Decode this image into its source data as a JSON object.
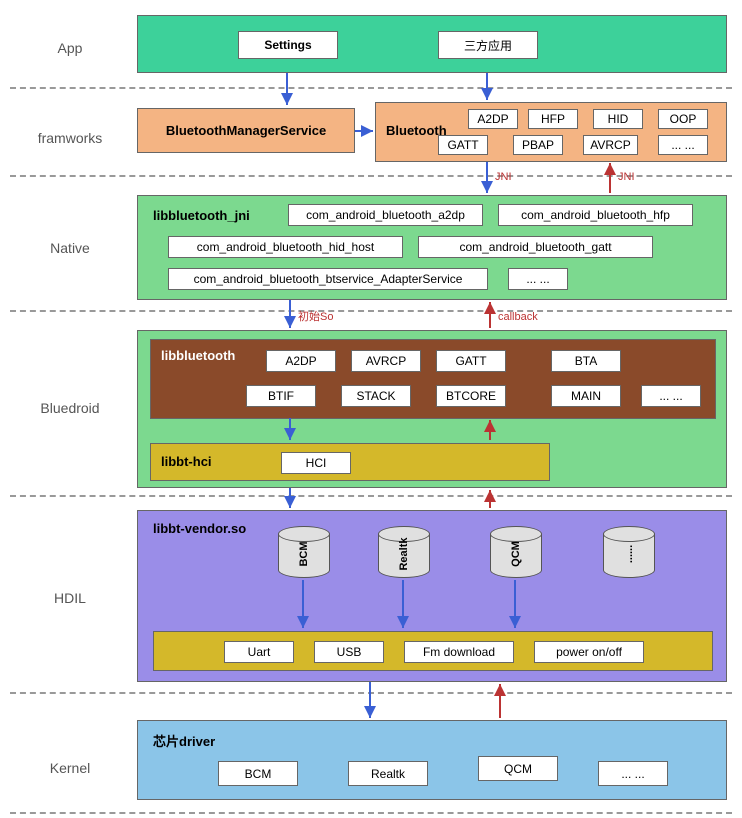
{
  "layers": {
    "app": "App",
    "frameworks": "framworks",
    "native": "Native",
    "bluedroid": "Bluedroid",
    "hdil": "HDIL",
    "kernel": "Kernel"
  },
  "app": {
    "settings": "Settings",
    "third_party": "三方应用"
  },
  "frameworks": {
    "bms": "BluetoothManagerService",
    "bluetooth": "Bluetooth",
    "profiles": {
      "a2dp": "A2DP",
      "hfp": "HFP",
      "hid": "HID",
      "oop": "OOP",
      "gatt": "GATT",
      "pbap": "PBAP",
      "avrcp": "AVRCP",
      "more": "... ..."
    }
  },
  "native": {
    "title": "libbluetooth_jni",
    "items": {
      "a2dp": "com_android_bluetooth_a2dp",
      "hfp": "com_android_bluetooth_hfp",
      "hid": "com_android_bluetooth_hid_host",
      "gatt": "com_android_bluetooth_gatt",
      "adapter": "com_android_bluetooth_btservice_AdapterService",
      "more": "... ..."
    }
  },
  "bluedroid": {
    "libbluetooth": "libbluetooth",
    "items": {
      "a2dp": "A2DP",
      "avrcp": "AVRCP",
      "gatt": "GATT",
      "bta": "BTA",
      "btif": "BTIF",
      "stack": "STACK",
      "btcore": "BTCORE",
      "main": "MAIN",
      "more": "... ..."
    },
    "libbt_hci": "libbt-hci",
    "hci": "HCI"
  },
  "hdil": {
    "title": "libbt-vendor.so",
    "cylinders": {
      "bcm": "BCM",
      "realtk": "Realtk",
      "qcm": "QCM",
      "more": "......"
    },
    "transport": {
      "uart": "Uart",
      "usb": "USB",
      "fm": "Fm download",
      "power": "power on/off"
    }
  },
  "kernel": {
    "title": "芯片driver",
    "items": {
      "bcm": "BCM",
      "realtk": "Realtk",
      "qcm": "QCM",
      "more": "... ..."
    }
  },
  "arrows": {
    "jni1": "JNI",
    "jni2": "JNI",
    "init": "初始So",
    "callback": "callback"
  }
}
